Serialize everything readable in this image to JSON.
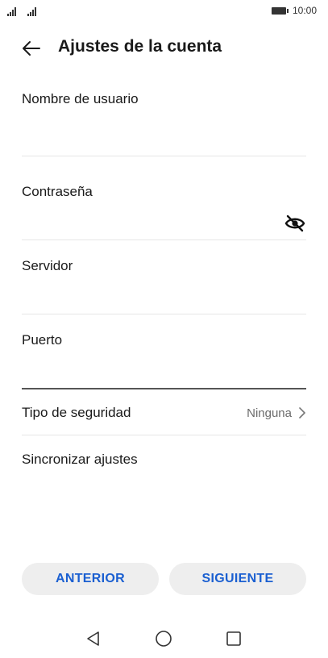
{
  "status_bar": {
    "time": "10:00"
  },
  "header": {
    "title": "Ajustes de la cuenta"
  },
  "form": {
    "username_label": "Nombre de usuario",
    "username_value": "",
    "password_label": "Contraseña",
    "password_value": "",
    "server_label": "Servidor",
    "server_value": "",
    "port_label": "Puerto",
    "port_value": ""
  },
  "security": {
    "label": "Tipo de seguridad",
    "value": "Ninguna"
  },
  "sync": {
    "label": "Sincronizar ajustes"
  },
  "buttons": {
    "previous": "ANTERIOR",
    "next": "SIGUIENTE"
  },
  "icons": {
    "back": "arrow-left-icon",
    "password_visibility": "eye-off-icon",
    "chevron": "chevron-right-icon",
    "nav_back": "triangle-back-icon",
    "nav_home": "circle-home-icon",
    "nav_recent": "square-recent-icon"
  },
  "colors": {
    "accent": "#1a5fd1",
    "button_bg": "#eeeeee",
    "divider": "#e6e6e6",
    "active_divider": "#555555",
    "secondary_text": "#6b6b6b"
  }
}
